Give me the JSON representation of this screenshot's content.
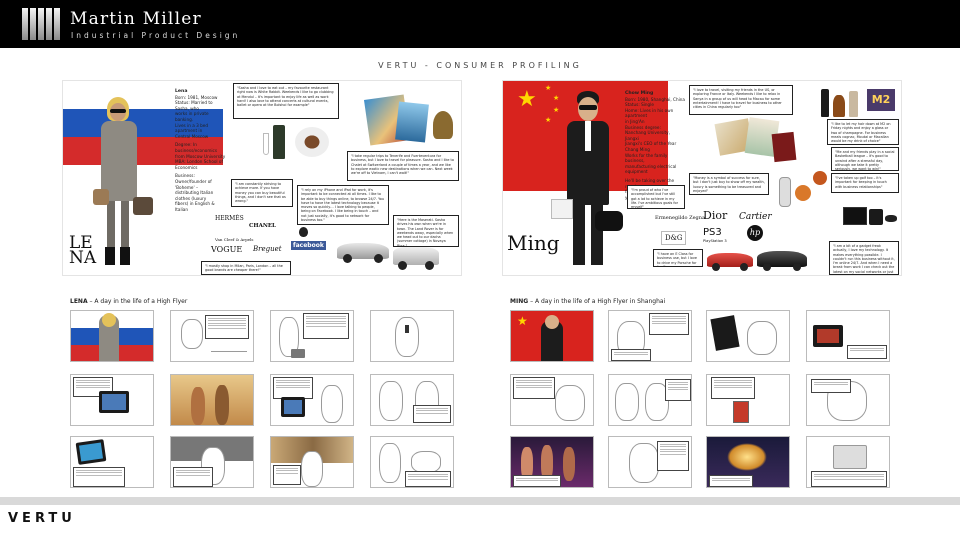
{
  "header": {
    "brand_name": "Martin Miller",
    "brand_subtitle": "Industrial Product Design"
  },
  "page_title": "VERTU - CONSUMER PROFILING",
  "lena": {
    "big_name_1": "LE",
    "big_name_2": "NA",
    "profile_name": "Lena",
    "profile_lines": [
      "Born: 1981, Moscow",
      "Status: Married to Sasha, who",
      "works in private banking.",
      "Lives in a 3 bed apartment in",
      "Central Moscow",
      "",
      "Degree: In business/economics",
      "from Moscow University",
      "MBA: London School of",
      "Economics",
      "",
      "Business:",
      "Owner/founder of 'Boheme' –",
      "distributing Italian clothes (luxury",
      "fibers) in English & Italian"
    ],
    "quotes": [
      "\"Sasha and I love to eat out – my favourite restaurant right now is White Rabbit. Weekends I like to go clubbing at Mendul – it's important to enjoy life as well as work hard! I also love to attend concerts at cultural events, ballet or opera at the Bolshoi for example\"",
      "\"I take regular trips to Tenerife and Fuerteventura for business, but I love to travel for pleasure. Sasha and I like to Chalet at Switzerland a couple of times a year, and we like to explore exotic new destinations when we can. Next week we're off to Vietnam, I can't wait!\"",
      "\"I am constantly striving to achieve more. If you have money you can buy beautiful things, and I don't see that as wrong.\"",
      "\"I rely on my iPhone and iPad for work, it's important to be connected at all times. I like to be able to buy things online, to browse 24/7. You have to have the latest technology because it moves so quickly… I love talking to people, being on Facebook. I like being in touch – and not just socially, it's good to network for business too.\"",
      "\"Here is the Maserati. Sasha drives his own when we're in town. The Land Rover is for weekends away, especially when we head out to our dacha (summer cottage) in Novaya Riga.\"",
      "\"I mostly shop in Milan, Paris, London – all the good brands are cheaper there!\""
    ],
    "brands": [
      "HERMÈS",
      "CHANEL",
      "Van Cleef & Arpels",
      "VOGUE",
      "Breguet",
      "facebook"
    ]
  },
  "ming": {
    "big_name": "Ming",
    "profile_name": "Chow Ming",
    "profile_lines": [
      "Born: 1980, Shanghai, China",
      "Status: Single",
      "Home: Lives in his own apartment",
      "in Jing'An",
      "Business degree:",
      "Nanchang University, Jiangxi",
      "Jiangxi's CEO of the Year",
      "Chang Ming",
      "Works for the family business,",
      "manufacturing electrical",
      "equipment",
      "",
      "He'll be taking over the running",
      "from his father in a few years time"
    ],
    "quotes": [
      "\"I love to travel, visiting my friends in the US, or exploring France or Italy. Weekends I like to relax in Sanya in a group of us will head to Macau for some entertainment! I have to travel for business to other cities in China regularly too\"",
      "\"I like to let my hair down at M2 on Friday nights and enjoy a glass or two of champagne. For business meals cognac, Moutai or Macallan would be my drink of choice\"",
      "\"Me and my friends play in a social Basketball league – it's good to unwind after a stressful day, although we take it pretty seriously, we want to win!\"",
      "\"I've taken up golf too – it's important for keeping in touch with business relationships\"",
      "\"I'm proud of who I've accomplished but I've still got a lot to achieve in my life. I've ambitious goals for myself\"",
      "\"Money is a symbol of success for sure, but I don't just buy to show off my wealth, luxury is something to be treasured and enjoyed\"",
      "\"I have an E Class for business use, but I love to drive my Porsche for fun!\"",
      "\"I am a bit of a gadget freak actually, I love my technology. It makes everything possible. I couldn't run this business without it, I'm online 24/7. And when I need a break from work I can check out the latest on my social networks or just enjoy a game or two\""
    ],
    "brands": [
      "Ermenegildo Zegna",
      "Dior",
      "Cartier",
      "D&G",
      "PS3",
      "hp",
      "PlayStation 3",
      "M2"
    ]
  },
  "storyboards": {
    "lena_title_bold": "LENA",
    "lena_title_rest": " – A day in the life of a High Flyer",
    "ming_title_bold": "MING",
    "ming_title_rest": " – A day in the life of a High Flyer in Shanghai"
  },
  "footer": {
    "logo": "VERTU"
  },
  "colors": {
    "header_bg": "#000000",
    "russia_blue": "#1f55b8",
    "russia_red": "#d42b2b",
    "china_red": "#d8231e",
    "china_gold": "#ffd700",
    "footer_bar": "#d9d9d9"
  }
}
